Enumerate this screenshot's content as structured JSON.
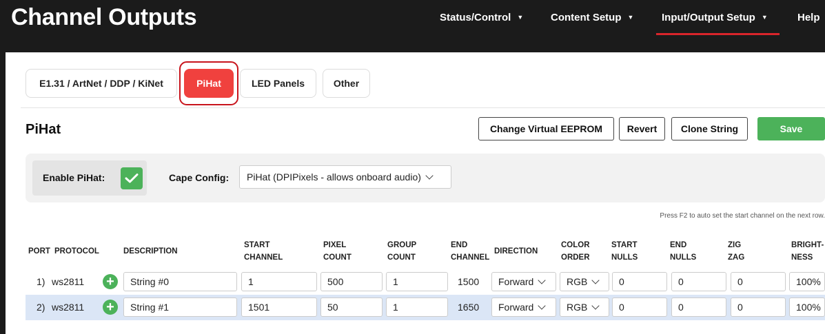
{
  "page_title": "Channel Outputs",
  "nav": [
    {
      "label": "Status/Control",
      "active": false
    },
    {
      "label": "Content Setup",
      "active": false
    },
    {
      "label": "Input/Output Setup",
      "active": true
    },
    {
      "label": "Help",
      "active": false
    }
  ],
  "tabs": [
    {
      "label": "E1.31 / ArtNet / DDP / KiNet",
      "active": false
    },
    {
      "label": "PiHat",
      "active": true
    },
    {
      "label": "LED Panels",
      "active": false
    },
    {
      "label": "Other",
      "active": false
    }
  ],
  "section": {
    "title": "PiHat"
  },
  "buttons": {
    "change_eeprom": "Change Virtual EEPROM",
    "revert": "Revert",
    "clone_string": "Clone String",
    "save": "Save"
  },
  "config": {
    "enable_label": "Enable PiHat:",
    "enable_checked": true,
    "cape_label": "Cape Config:",
    "cape_value": "PiHat (DPIPixels - allows onboard audio)"
  },
  "hint": "Press F2 to auto set the start channel on the next row.",
  "table": {
    "headers": [
      {
        "key": "port",
        "label": "PORT"
      },
      {
        "key": "protocol",
        "label": "PROTOCOL"
      },
      {
        "key": "description",
        "label": "DESCRIPTION"
      },
      {
        "key": "start_channel",
        "line1": "START",
        "line2": "CHANNEL"
      },
      {
        "key": "pixel_count",
        "line1": "PIXEL",
        "line2": "COUNT"
      },
      {
        "key": "group_count",
        "line1": "GROUP",
        "line2": "COUNT"
      },
      {
        "key": "end_channel",
        "line1": "END",
        "line2": "CHANNEL"
      },
      {
        "key": "direction",
        "label": "DIRECTION"
      },
      {
        "key": "color_order",
        "line1": "COLOR",
        "line2": "ORDER"
      },
      {
        "key": "start_nulls",
        "line1": "START",
        "line2": "NULLS"
      },
      {
        "key": "end_nulls",
        "line1": "END",
        "line2": "NULLS"
      },
      {
        "key": "zig_zag",
        "line1": "ZIG",
        "line2": "ZAG"
      },
      {
        "key": "brightness",
        "line1": "BRIGHT-",
        "line2": "NESS"
      }
    ],
    "rows": [
      {
        "port": "1)",
        "protocol": "ws2811",
        "description": "String #0",
        "start_channel": "1",
        "pixel_count": "500",
        "group_count": "1",
        "end_channel": "1500",
        "direction": "Forward",
        "color_order": "RGB",
        "start_nulls": "0",
        "end_nulls": "0",
        "zig_zag": "0",
        "brightness": "100%"
      },
      {
        "port": "2)",
        "protocol": "ws2811",
        "description": "String #1",
        "start_channel": "1501",
        "pixel_count": "50",
        "group_count": "1",
        "end_channel": "1650",
        "direction": "Forward",
        "color_order": "RGB",
        "start_nulls": "0",
        "end_nulls": "0",
        "zig_zag": "0",
        "brightness": "100%"
      }
    ]
  },
  "colors": {
    "accent_red": "#f0413e",
    "save_green": "#4cb25a",
    "nav_underline": "#d9252b",
    "alt_row": "#dbe6f6"
  }
}
